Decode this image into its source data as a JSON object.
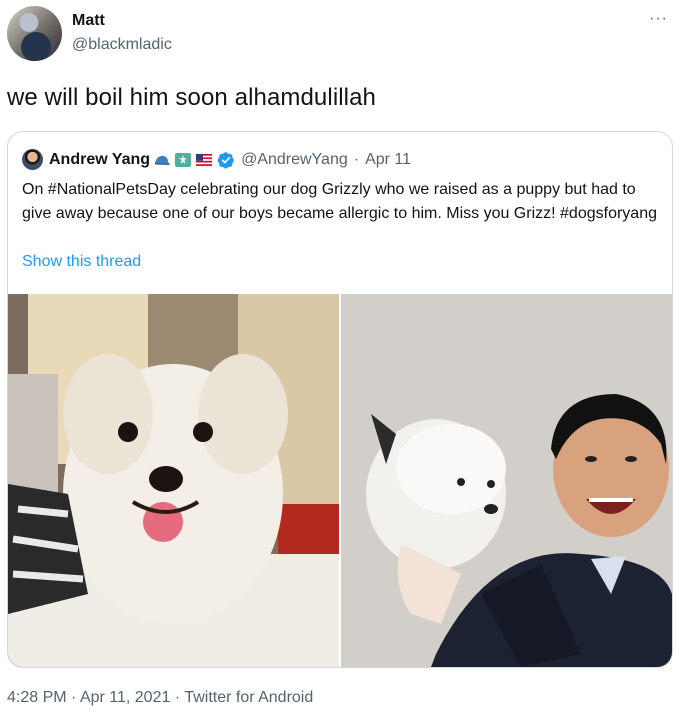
{
  "tweet": {
    "author": {
      "display_name": "Matt",
      "handle": "@blackmladic"
    },
    "text": "we will boil him soon alhamdulillah",
    "more_label": "···"
  },
  "quoted": {
    "author": {
      "display_name": "Andrew Yang",
      "emojis": [
        "blue-cap-emoji",
        "statue-of-liberty-emoji",
        "us-flag-emoji"
      ],
      "handle": "@AndrewYang",
      "date": "Apr 11"
    },
    "text": "On #NationalPetsDay celebrating our dog Grizzly who we raised as a puppy but had to give away because one of our boys became allergic to him. Miss you Grizz! #dogsforyang",
    "show_thread": "Show this thread",
    "media": [
      "photo-dog-on-couch",
      "photo-man-holding-dog"
    ]
  },
  "footer": {
    "time": "4:28 PM",
    "date": "Apr 11, 2021",
    "source": "Twitter for Android"
  },
  "colors": {
    "link": "#1d9bf0",
    "secondary_text": "#536471",
    "border": "#cfd9de",
    "verified": "#1d9bf0"
  }
}
